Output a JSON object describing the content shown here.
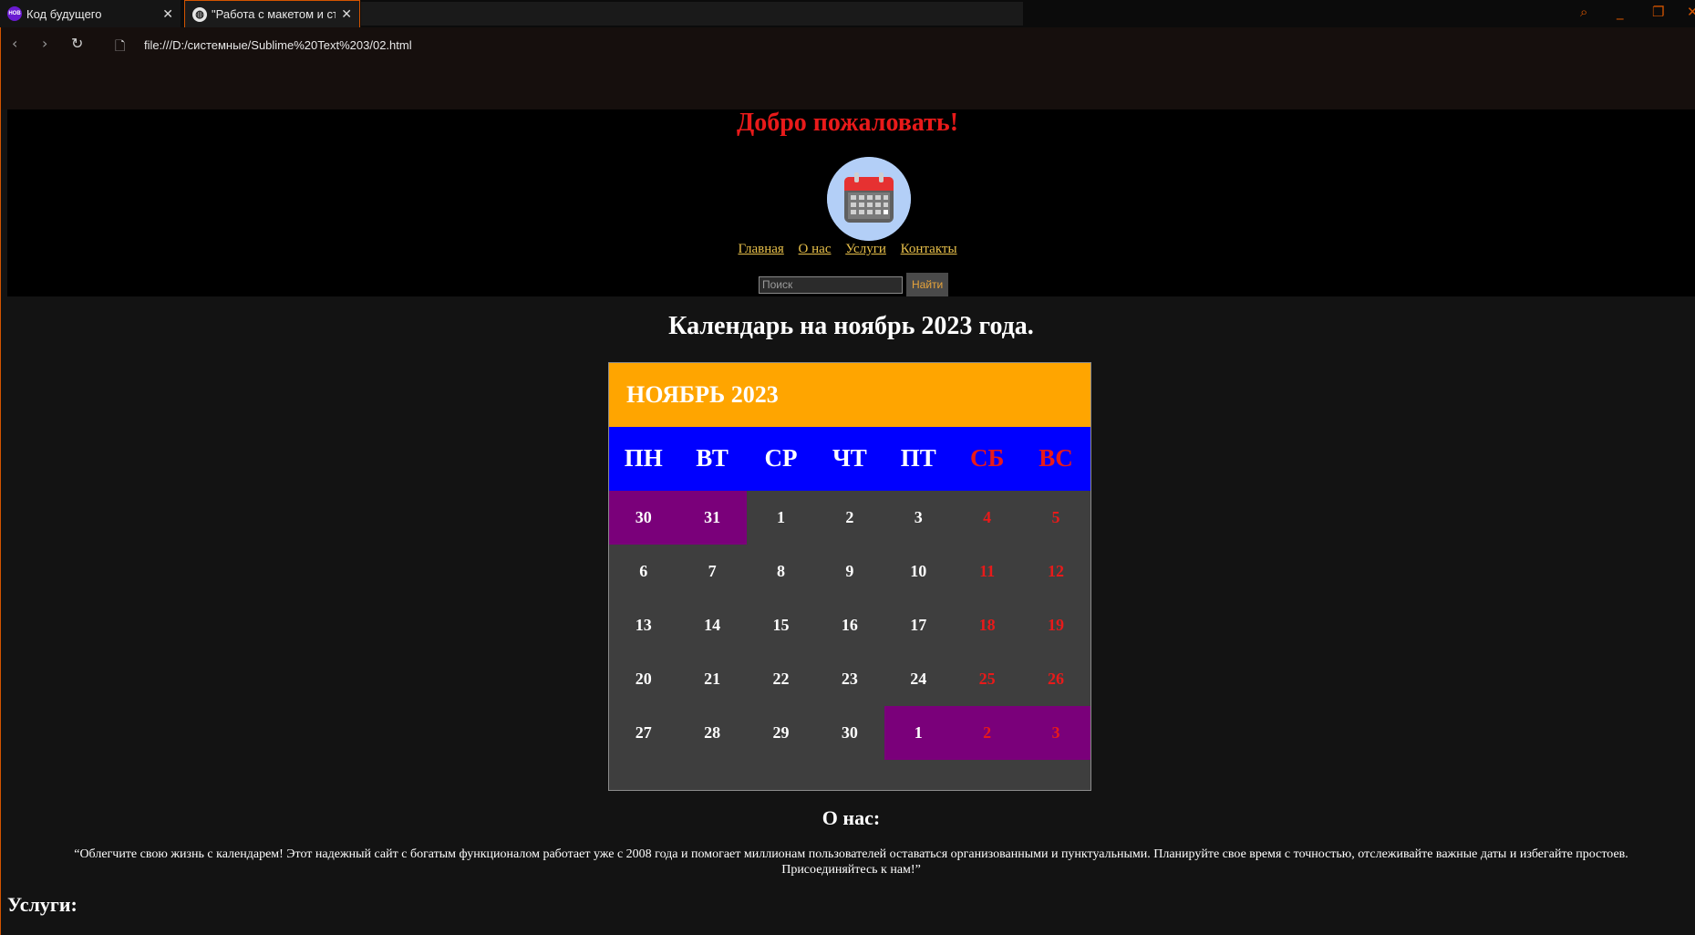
{
  "browser": {
    "tabs": [
      {
        "title": "Код будущего",
        "favicon": "HOB"
      },
      {
        "title": "\"Работа с макетом и структурой\"",
        "favicon": "globe"
      }
    ],
    "url": "file:///D:/системные/Sublime%20Text%203/02.html",
    "accent_color": "#d35400"
  },
  "header": {
    "welcome": "Добро пожаловать!",
    "logo": "calendar-icon",
    "nav": [
      "Главная",
      "О нас",
      "Услуги",
      "Контакты"
    ],
    "search_placeholder": "Поиск",
    "search_button": "Найти"
  },
  "calendar": {
    "heading": "Календарь на ноябрь 2023 года.",
    "month_label": "НОЯБРЬ 2023",
    "weekdays": [
      "ПН",
      "ВТ",
      "СР",
      "ЧТ",
      "ПТ",
      "СБ",
      "ВС"
    ],
    "days": [
      [
        "30",
        "31",
        "1",
        "2",
        "3",
        "4",
        "5"
      ],
      [
        "6",
        "7",
        "8",
        "9",
        "10",
        "11",
        "12"
      ],
      [
        "13",
        "14",
        "15",
        "16",
        "17",
        "18",
        "19"
      ],
      [
        "20",
        "21",
        "22",
        "23",
        "24",
        "25",
        "26"
      ],
      [
        "27",
        "28",
        "29",
        "30",
        "1",
        "2",
        "3"
      ]
    ],
    "other_month_cells": [
      [
        0,
        0
      ],
      [
        0,
        1
      ],
      [
        4,
        4
      ],
      [
        4,
        5
      ],
      [
        4,
        6
      ]
    ],
    "colors": {
      "month_bg": "#ffa500",
      "weekday_bg": "#0000ff",
      "weekend": "#e81a1a",
      "other_month_bg": "#7a007a",
      "body_bg": "#3e3e3e"
    }
  },
  "about": {
    "heading": "О нас:",
    "text": "“Облегчите свою жизнь с календарем! Этот надежный сайт с богатым функционалом работает уже с 2008 года и помогает миллионам пользователей оставаться организованными и пунктуальными. Планируйте свое время с точностью, отслеживайте важные даты и избегайте простоев. Присоединяйтесь к нам!”"
  },
  "services": {
    "heading": "Услуги:"
  }
}
